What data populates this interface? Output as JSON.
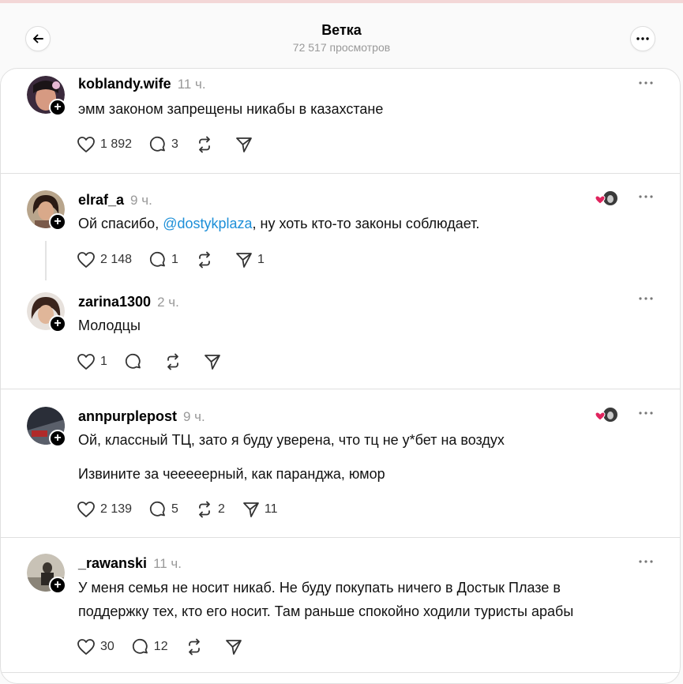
{
  "header": {
    "title": "Ветка",
    "subtitle": "72 517 просмотров"
  },
  "posts": [
    {
      "username": "koblandy.wife",
      "time": "11 ч.",
      "lines": [
        "эмм законом запрещены никабы в казахстане"
      ],
      "likes": "1 892",
      "replies": "3",
      "reposts": "",
      "shares": ""
    },
    {
      "username": "elraf_a",
      "time": "9 ч.",
      "text_before": "Ой спасибо, ",
      "mention": "@dostykplaza",
      "text_after": ", ну хоть кто-то законы соблюдает.",
      "likes": "2 148",
      "replies": "1",
      "reposts": "",
      "shares": "1"
    },
    {
      "username": "zarina1300",
      "time": "2 ч.",
      "lines": [
        "Молодцы"
      ],
      "likes": "1",
      "replies": "",
      "reposts": "",
      "shares": ""
    },
    {
      "username": "annpurplepost",
      "time": "9 ч.",
      "lines": [
        "Ой, классный ТЦ, зато я буду уверена, что тц не у*бет на воздух",
        "Извините за чеееееpный, как паранджа, юмор"
      ],
      "likes": "2 139",
      "replies": "5",
      "reposts": "2",
      "shares": "11"
    },
    {
      "username": "_rawanski",
      "time": "11 ч.",
      "lines": [
        "У меня семья не носит никаб. Не буду покупать ничего в Достык Плазе в",
        "поддержку тех, кто его носит. Там раньше спокойно ходили туристы арабы"
      ],
      "likes": "30",
      "replies": "12",
      "reposts": "",
      "shares": ""
    }
  ],
  "plus_glyph": "+",
  "colors": {
    "mention": "#1d8fd8",
    "liked_heart": "#e0245e",
    "muted": "#999999"
  }
}
